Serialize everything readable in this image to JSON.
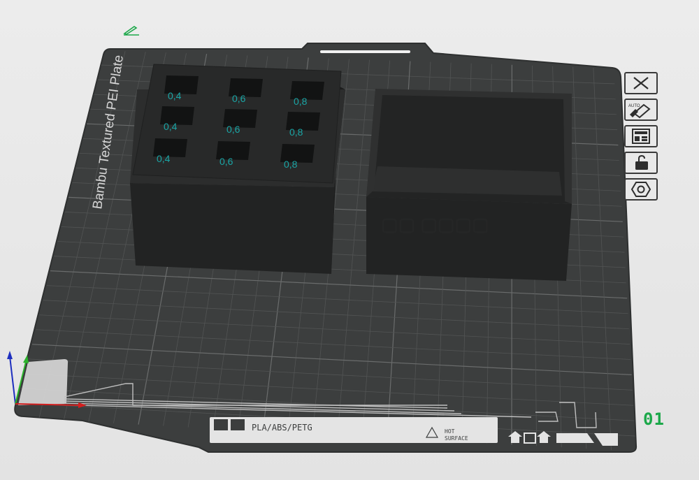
{
  "plate": {
    "name": "Bambu Textured PEI Plate",
    "filament_label": "PLA/ABS/PETG",
    "warning_label_line1": "HOT",
    "warning_label_line2": "SURFACE",
    "number": "01"
  },
  "models": {
    "tray": {
      "slot_labels": [
        "0,4",
        "0,6",
        "0,8",
        "0,4",
        "0,6",
        "0,8",
        "0,4",
        "0,6",
        "0,8"
      ]
    },
    "box": {}
  },
  "toolbar": {
    "buttons": [
      {
        "name": "close-plate-button",
        "icon": "close-x-icon"
      },
      {
        "name": "auto-orient-button",
        "icon": "auto-orient-icon",
        "badge": "AUTO"
      },
      {
        "name": "arrange-button",
        "icon": "arrange-layout-icon"
      },
      {
        "name": "lock-plate-button",
        "icon": "lock-icon"
      },
      {
        "name": "plate-settings-button",
        "icon": "hex-nut-icon"
      }
    ]
  },
  "colors": {
    "background": "#e6e6e6",
    "plate": "#3b3d3d",
    "model": "#262727",
    "grid": "#5a5c5c",
    "label_text": "#1aa6a6",
    "plate_number": "#1ca84a",
    "axis_x": "#d21e1e",
    "axis_y": "#2cb32c",
    "axis_z": "#1e2fbf"
  }
}
